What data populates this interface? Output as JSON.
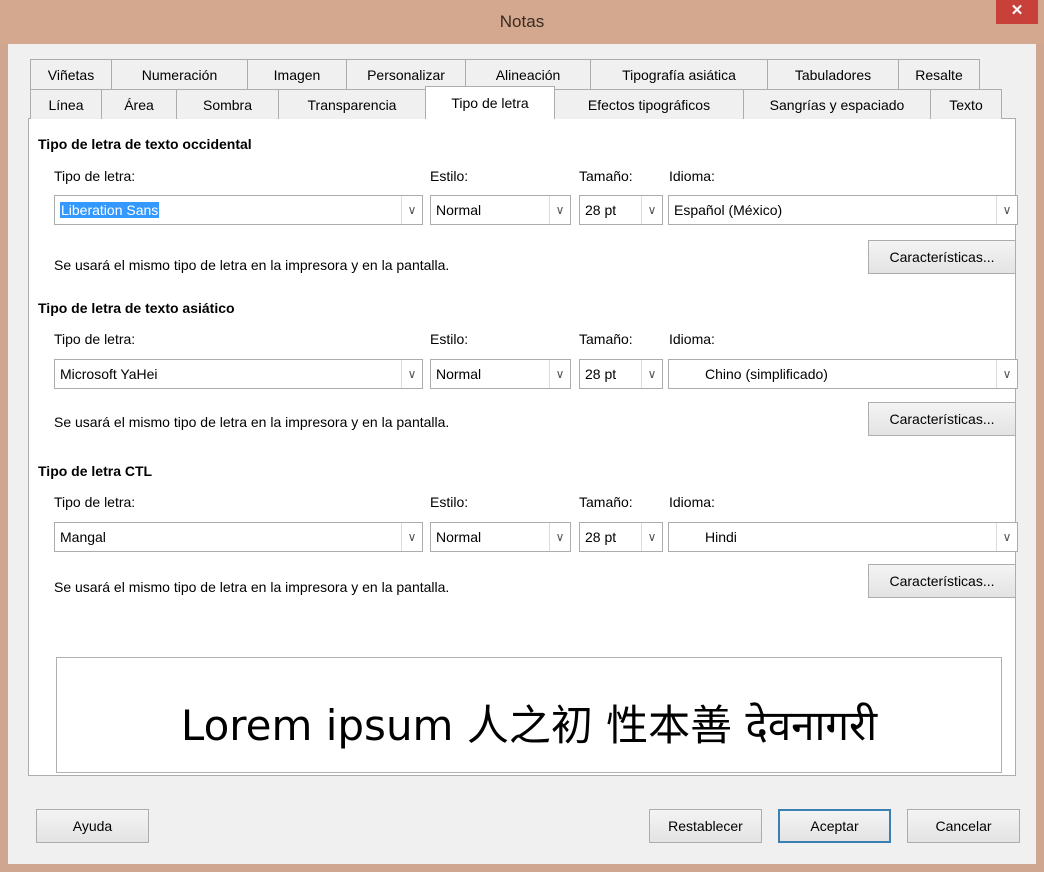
{
  "window": {
    "title": "Notas",
    "close": "✕"
  },
  "tabs": {
    "row1": [
      "Viñetas",
      "Numeración",
      "Imagen",
      "Personalizar",
      "Alineación",
      "Tipografía asiática",
      "Tabuladores",
      "Resalte"
    ],
    "row2": [
      "Línea",
      "Área",
      "Sombra",
      "Transparencia",
      "Tipo de letra",
      "Efectos tipográficos",
      "Sangrías y espaciado",
      "Texto"
    ],
    "active": "Tipo de letra"
  },
  "western": {
    "title": "Tipo de letra de texto occidental",
    "font_label": "Tipo de letra:",
    "style_label": "Estilo:",
    "size_label": "Tamaño:",
    "lang_label": "Idioma:",
    "font": "Liberation Sans",
    "style": "Normal",
    "size": "28 pt",
    "lang": "Español (México)",
    "note": "Se usará el mismo tipo de letra en la impresora y en la pantalla.",
    "features": "Características..."
  },
  "asian": {
    "title": "Tipo de letra de texto asiático",
    "font_label": "Tipo de letra:",
    "style_label": "Estilo:",
    "size_label": "Tamaño:",
    "lang_label": "Idioma:",
    "font": "Microsoft YaHei",
    "style": "Normal",
    "size": "28 pt",
    "lang": "Chino (simplificado)",
    "note": "Se usará el mismo tipo de letra en la impresora y en la pantalla.",
    "features": "Características..."
  },
  "ctl": {
    "title": "Tipo de letra CTL",
    "font_label": "Tipo de letra:",
    "style_label": "Estilo:",
    "size_label": "Tamaño:",
    "lang_label": "Idioma:",
    "font": "Mangal",
    "style": "Normal",
    "size": "28 pt",
    "lang": "Hindi",
    "note": "Se usará el mismo tipo de letra en la impresora y en la pantalla.",
    "features": "Características..."
  },
  "preview": {
    "text": "Lorem ipsum   人之初 性本善   देवनागरी"
  },
  "buttons": {
    "help": "Ayuda",
    "reset": "Restablecer",
    "ok": "Aceptar",
    "cancel": "Cancelar"
  },
  "icons": {
    "dropdown": "chevron-down-icon",
    "close": "close-icon"
  }
}
